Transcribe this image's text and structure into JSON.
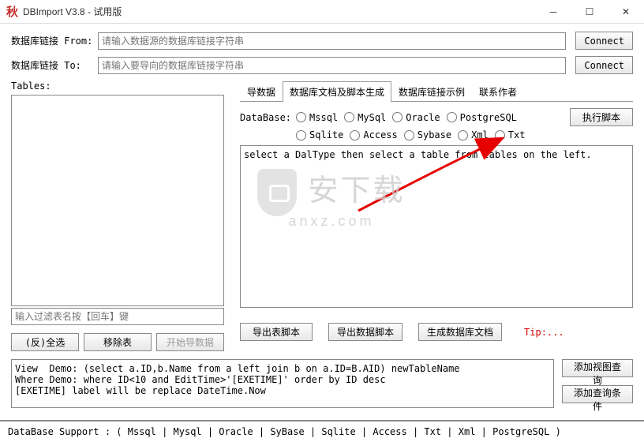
{
  "window": {
    "title": "DBImport V3.8 - 试用版",
    "app_icon": "秋"
  },
  "conn": {
    "from_label": "数据库链接 From:",
    "from_placeholder": "请输入数据源的数据库链接字符串",
    "to_label": "数据库链接 To:",
    "to_placeholder": "请输入要导向的数据库链接字符串",
    "connect_btn": "Connect"
  },
  "tables": {
    "label": "Tables:",
    "filter_placeholder": "输入过滤表名按【回车】键",
    "select_all": "(反)全选",
    "remove": "移除表",
    "start_import": "开始导数据"
  },
  "tabs": {
    "t0": "导数据",
    "t1": "数据库文档及脚本生成",
    "t2": "数据库链接示例",
    "t3": "联系作者"
  },
  "db": {
    "label": "DataBase:",
    "r0": "Mssql",
    "r1": "MySql",
    "r2": "Oracle",
    "r3": "PostgreSQL",
    "r4": "Sqlite",
    "r5": "Access",
    "r6": "Sybase",
    "r7": "Xml",
    "r8": "Txt",
    "run": "执行脚本"
  },
  "script_text": "select a DalType then select a table from tables on the left.",
  "export": {
    "b0": "导出表脚本",
    "b1": "导出数据脚本",
    "b2": "生成数据库文档",
    "tip": "Tip:..."
  },
  "demo": "View  Demo: (select a.ID,b.Name from a left join b on a.ID=B.AID) newTableName\nWhere Demo: where ID<10 and EditTime>'[EXETIME]' order by ID desc\n[EXETIME] label will be replace DateTime.Now",
  "side": {
    "add_view": "添加视图查询",
    "add_where": "添加查询条件"
  },
  "footer": "DataBase Support :  ( Mssql | Mysql | Oracle | SyBase | Sqlite | Access | Txt | Xml | PostgreSQL )",
  "watermark": {
    "main": "安下载",
    "sub": "anxz.com"
  }
}
